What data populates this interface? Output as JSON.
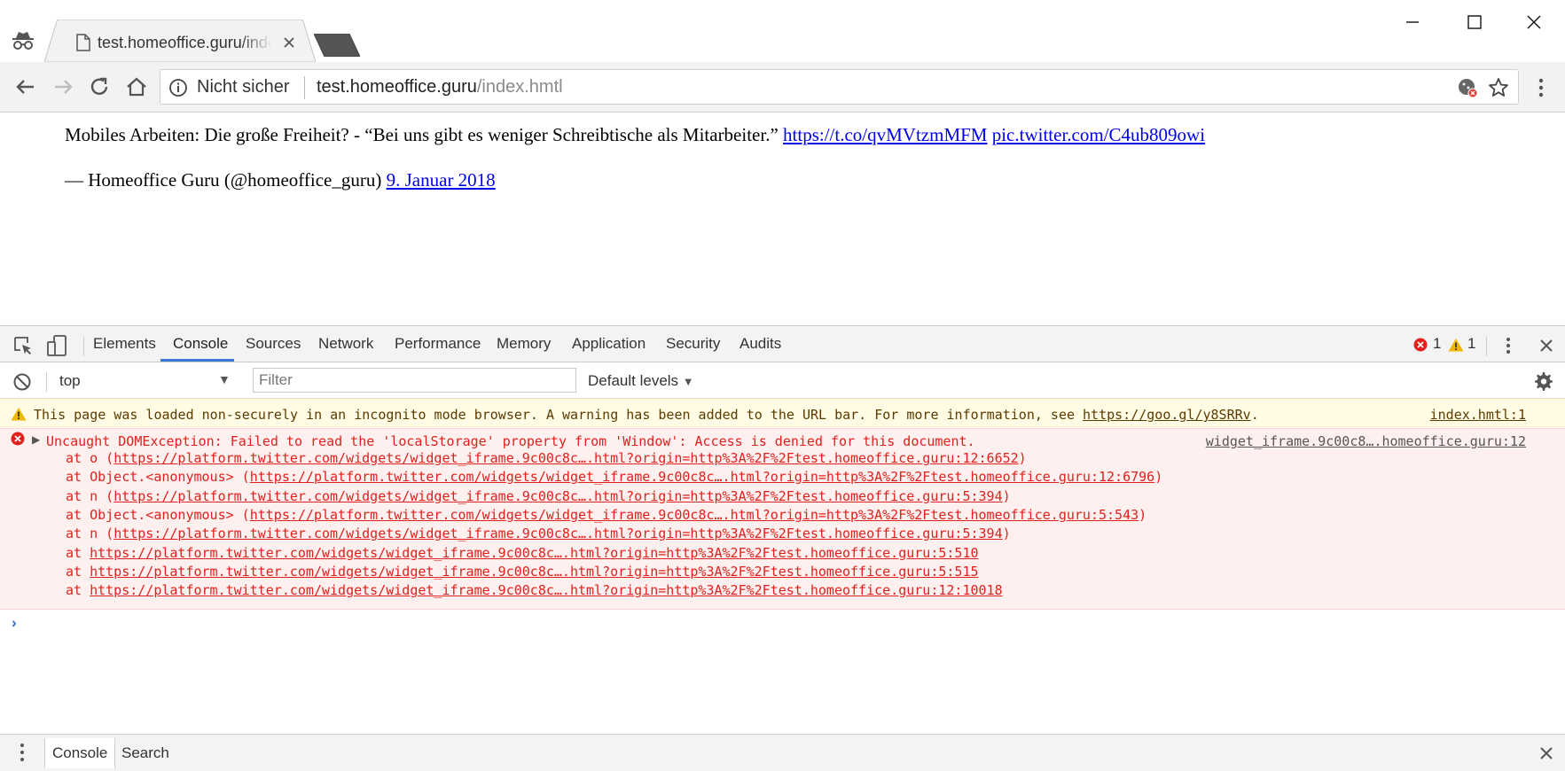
{
  "browser": {
    "tab": {
      "title": "test.homeoffice.guru/index.hmtl"
    },
    "omnibox": {
      "security_label": "Nicht sicher",
      "url_host": "test.homeoffice.guru",
      "url_path": "/index.hmtl"
    },
    "window_controls": [
      "minimize-icon",
      "maximize-icon",
      "close-icon"
    ]
  },
  "page": {
    "tweet_text": "Mobiles Arbeiten: Die große Freiheit? - “Bei uns gibt es weniger Schreibtische als Mitarbeiter.”",
    "tweet_link1": "https://t.co/qvMVtzmMFM",
    "tweet_link2": "pic.twitter.com/C4ub809owi",
    "author": "— Homeoffice Guru (@homeoffice_guru)",
    "date": "9. Januar 2018"
  },
  "devtools": {
    "tabs": [
      "Elements",
      "Console",
      "Sources",
      "Network",
      "Performance",
      "Memory",
      "Application",
      "Security",
      "Audits"
    ],
    "active_tab": "Console",
    "error_count": "1",
    "warning_count": "1",
    "context": "top",
    "filter_placeholder": "Filter",
    "levels": "Default levels",
    "warning": {
      "text": "This page was loaded non-securely in an incognito mode browser. A warning has been added to the URL bar. For more information, see ",
      "link": "https://goo.gl/y8SRRv",
      "link_suffix": ".",
      "source": "index.hmtl:1"
    },
    "error": {
      "message": "Uncaught DOMException: Failed to read the 'localStorage' property from 'Window': Access is denied for this document.",
      "source": "widget_iframe.9c00c8….homeoffice.guru:12",
      "trace": [
        {
          "fn": "o",
          "url": "https://platform.twitter.com/widgets/widget_iframe.9c00c8c….html?origin=http%3A%2F%2Ftest.homeoffice.guru:12:6652"
        },
        {
          "fn": "Object.<anonymous>",
          "url": "https://platform.twitter.com/widgets/widget_iframe.9c00c8c….html?origin=http%3A%2F%2Ftest.homeoffice.guru:12:6796"
        },
        {
          "fn": "n",
          "url": "https://platform.twitter.com/widgets/widget_iframe.9c00c8c….html?origin=http%3A%2F%2Ftest.homeoffice.guru:5:394"
        },
        {
          "fn": "Object.<anonymous>",
          "url": "https://platform.twitter.com/widgets/widget_iframe.9c00c8c….html?origin=http%3A%2F%2Ftest.homeoffice.guru:5:543"
        },
        {
          "fn": "n",
          "url": "https://platform.twitter.com/widgets/widget_iframe.9c00c8c….html?origin=http%3A%2F%2Ftest.homeoffice.guru:5:394"
        },
        {
          "fn": "",
          "url": "https://platform.twitter.com/widgets/widget_iframe.9c00c8c….html?origin=http%3A%2F%2Ftest.homeoffice.guru:5:510"
        },
        {
          "fn": "",
          "url": "https://platform.twitter.com/widgets/widget_iframe.9c00c8c….html?origin=http%3A%2F%2Ftest.homeoffice.guru:5:515"
        },
        {
          "fn": "",
          "url": "https://platform.twitter.com/widgets/widget_iframe.9c00c8c….html?origin=http%3A%2F%2Ftest.homeoffice.guru:12:10018"
        }
      ]
    },
    "drawer": {
      "tabs": [
        "Console",
        "Search"
      ]
    }
  },
  "colors": {
    "toolbar_bg": "#f2f2f2",
    "error_red": "#e0211d",
    "error_bg": "#fff0f0",
    "warning_bg": "#fffbe5",
    "link_blue": "#0000ee",
    "tab_active_blue": "#3879d9"
  }
}
